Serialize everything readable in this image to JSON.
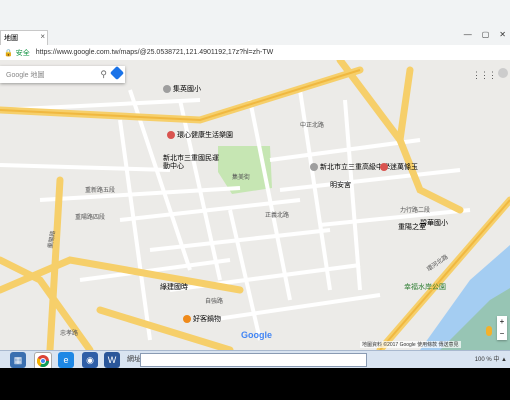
{
  "browser": {
    "tab_title": "地圖",
    "tab_close": "×",
    "win_buttons": [
      "—",
      "▢",
      "✕"
    ],
    "lock_icon": "🔒",
    "secure_label": "安全",
    "url": "https://www.google.com.tw/maps/@25.0538721,121.4901192,17z?hl=zh-TW"
  },
  "map": {
    "search_placeholder": "Google 地圖",
    "google_logo": "Google",
    "copyright": "地圖資料 ©2017 Google   使用條款   傳送意見",
    "zoom_plus": "+",
    "zoom_minus": "−",
    "pois": [
      {
        "label": "集英國小",
        "color": "#9e9e9e"
      },
      {
        "label": "環心健康生活樂園",
        "color": "#d9534f"
      },
      {
        "label": "新北市三重國民運動中心",
        "color": "#9e9e9e"
      },
      {
        "label": "新北市立三重高級中學",
        "color": "#9e9e9e"
      },
      {
        "label": "迷萬條玉",
        "color": "#d9534f"
      },
      {
        "label": "明安宮",
        "color": "#9e9e9e"
      },
      {
        "label": "碧華國小",
        "color": "#9e9e9e"
      },
      {
        "label": "幸福水岸公園",
        "color": "#4caf50"
      },
      {
        "label": "綠建國時",
        "color": "#9e9e9e"
      },
      {
        "label": "好客鍋物",
        "color": "#ef8a1a"
      },
      {
        "label": "重陽之室",
        "color": "#9e9e9e"
      }
    ],
    "roads": [
      "重新路五段",
      "重陽路四段",
      "重陽路",
      "集美街",
      "中正北路",
      "正義北路",
      "大同北路",
      "三民街",
      "仁愛街",
      "光明路",
      "重安街",
      "信義西街",
      "自強路",
      "碧華街",
      "力行路二段",
      "忠孝路",
      "環河北路",
      "堤外便道",
      "重新橋"
    ],
    "route_shields": [
      "104",
      "104",
      "1",
      "64"
    ]
  },
  "taskbar": {
    "address_label": "網址",
    "tray_text": "100 % 中 ▲"
  },
  "colors": {
    "map_bg": "#ecebe8",
    "major_road": "#f6cf6a",
    "minor_road": "#ffffff",
    "park": "#c6e6b3",
    "river": "#a4cdf2",
    "accent": "#1a73e8"
  }
}
